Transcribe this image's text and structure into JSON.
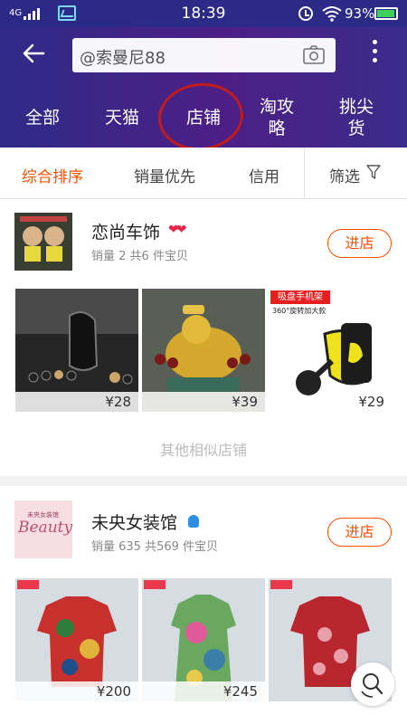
{
  "status_bar": {
    "network": "4G",
    "time": "18:39",
    "battery": "93%"
  },
  "header": {
    "search_value": "@索曼尼88",
    "tabs": [
      {
        "label": "全部"
      },
      {
        "label": "天猫"
      },
      {
        "label": "店铺"
      },
      {
        "label": "淘攻\n略"
      },
      {
        "label": "挑尖\n货"
      }
    ]
  },
  "sort_bar": {
    "items": [
      "综合排序",
      "销量优先",
      "信用",
      "筛选"
    ],
    "active_index": 0
  },
  "shops": [
    {
      "name": "恋尚车饰",
      "meta": "销量 2   共6 件宝贝",
      "enter_label": "进店",
      "products": [
        {
          "price": "¥28",
          "label": ""
        },
        {
          "price": "¥39",
          "label": ""
        },
        {
          "price": "¥29",
          "label": "吸盘手机架",
          "sub": "360°旋转加大款"
        }
      ],
      "similar": "其他相似店铺"
    },
    {
      "name": "未央女装馆",
      "meta": "销量 635   共569 件宝贝",
      "enter_label": "进店",
      "logo_text": "未央女装馆",
      "logo_script": "Beauty",
      "products": [
        {
          "price": "¥200"
        },
        {
          "price": "¥245"
        },
        {
          "price": ""
        }
      ]
    }
  ],
  "colors": {
    "accent": "#ff5000",
    "header": "#2e2b86",
    "circle": "#c11b1b"
  }
}
